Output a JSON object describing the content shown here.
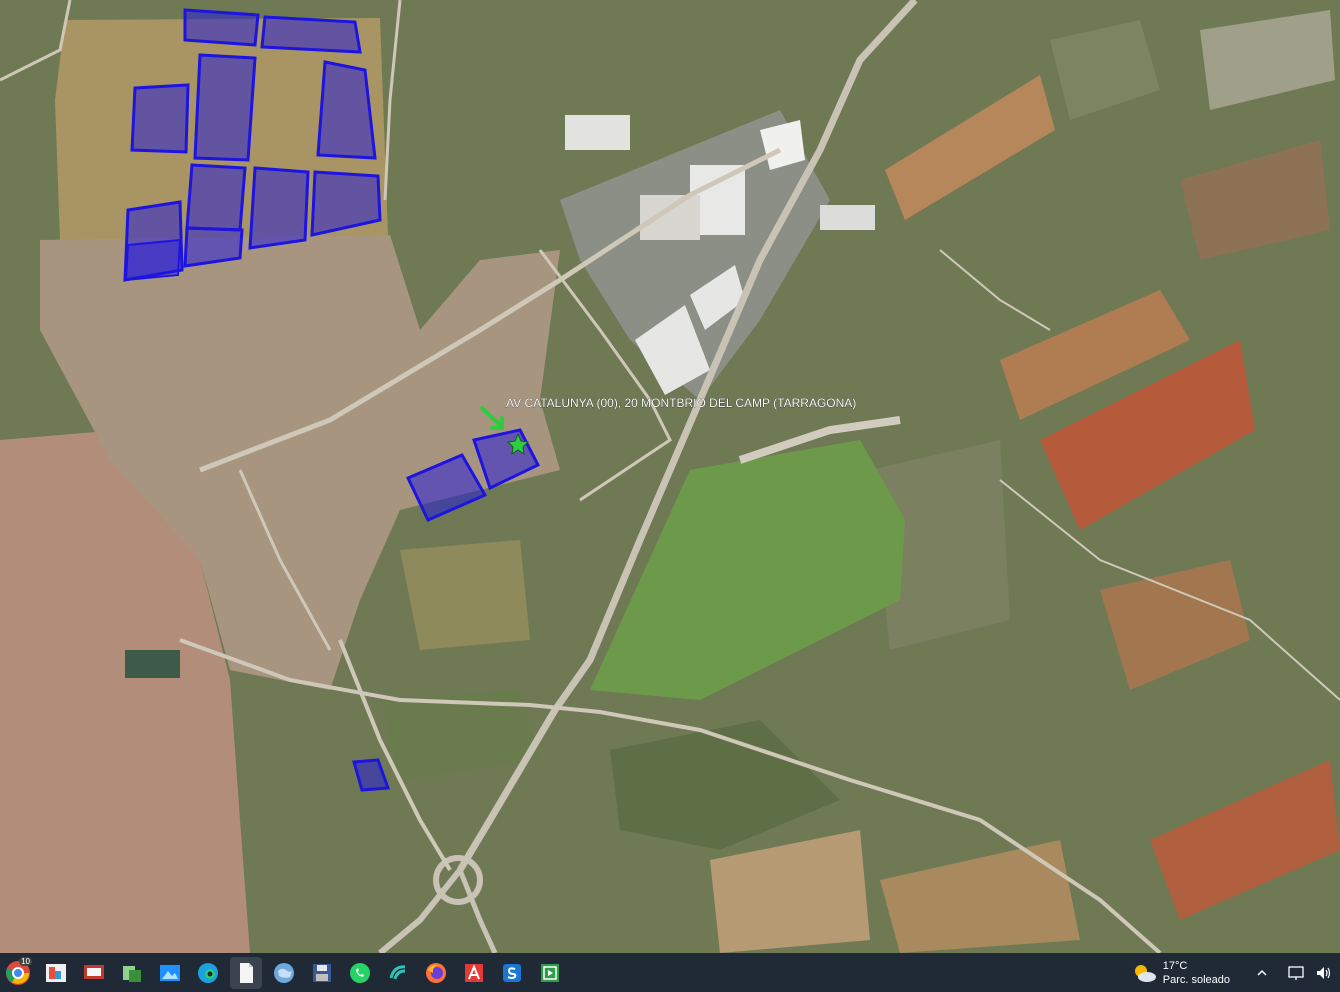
{
  "map": {
    "placemark_label": "AV CATALUNYA (00), 20  MONTBRIO DEL CAMP (TARRAGONA)",
    "parcel_color": "#1e14e0",
    "placemark_color": "#2ecc40",
    "plots": [
      {
        "id": "north-1"
      },
      {
        "id": "north-2"
      },
      {
        "id": "north-3"
      },
      {
        "id": "north-4"
      },
      {
        "id": "north-5"
      },
      {
        "id": "north-6"
      },
      {
        "id": "north-7"
      },
      {
        "id": "north-8"
      },
      {
        "id": "north-9"
      },
      {
        "id": "north-10"
      },
      {
        "id": "north-11"
      },
      {
        "id": "central-1"
      },
      {
        "id": "central-2"
      },
      {
        "id": "south-1"
      }
    ]
  },
  "taskbar": {
    "chrome_badge": "10",
    "apps": [
      {
        "name": "chrome-icon"
      },
      {
        "name": "image-viewer-icon"
      },
      {
        "name": "presentation-icon"
      },
      {
        "name": "file-transfer-icon"
      },
      {
        "name": "photos-icon"
      },
      {
        "name": "edge-icon"
      },
      {
        "name": "document-icon"
      },
      {
        "name": "google-earth-icon"
      },
      {
        "name": "save-disk-icon"
      },
      {
        "name": "whatsapp-icon"
      },
      {
        "name": "wave-app-icon"
      },
      {
        "name": "firefox-icon"
      },
      {
        "name": "acrobat-icon"
      },
      {
        "name": "s-app-icon"
      },
      {
        "name": "media-player-icon"
      }
    ],
    "weather": {
      "temperature": "17°C",
      "condition": "Parc. soleado"
    }
  }
}
